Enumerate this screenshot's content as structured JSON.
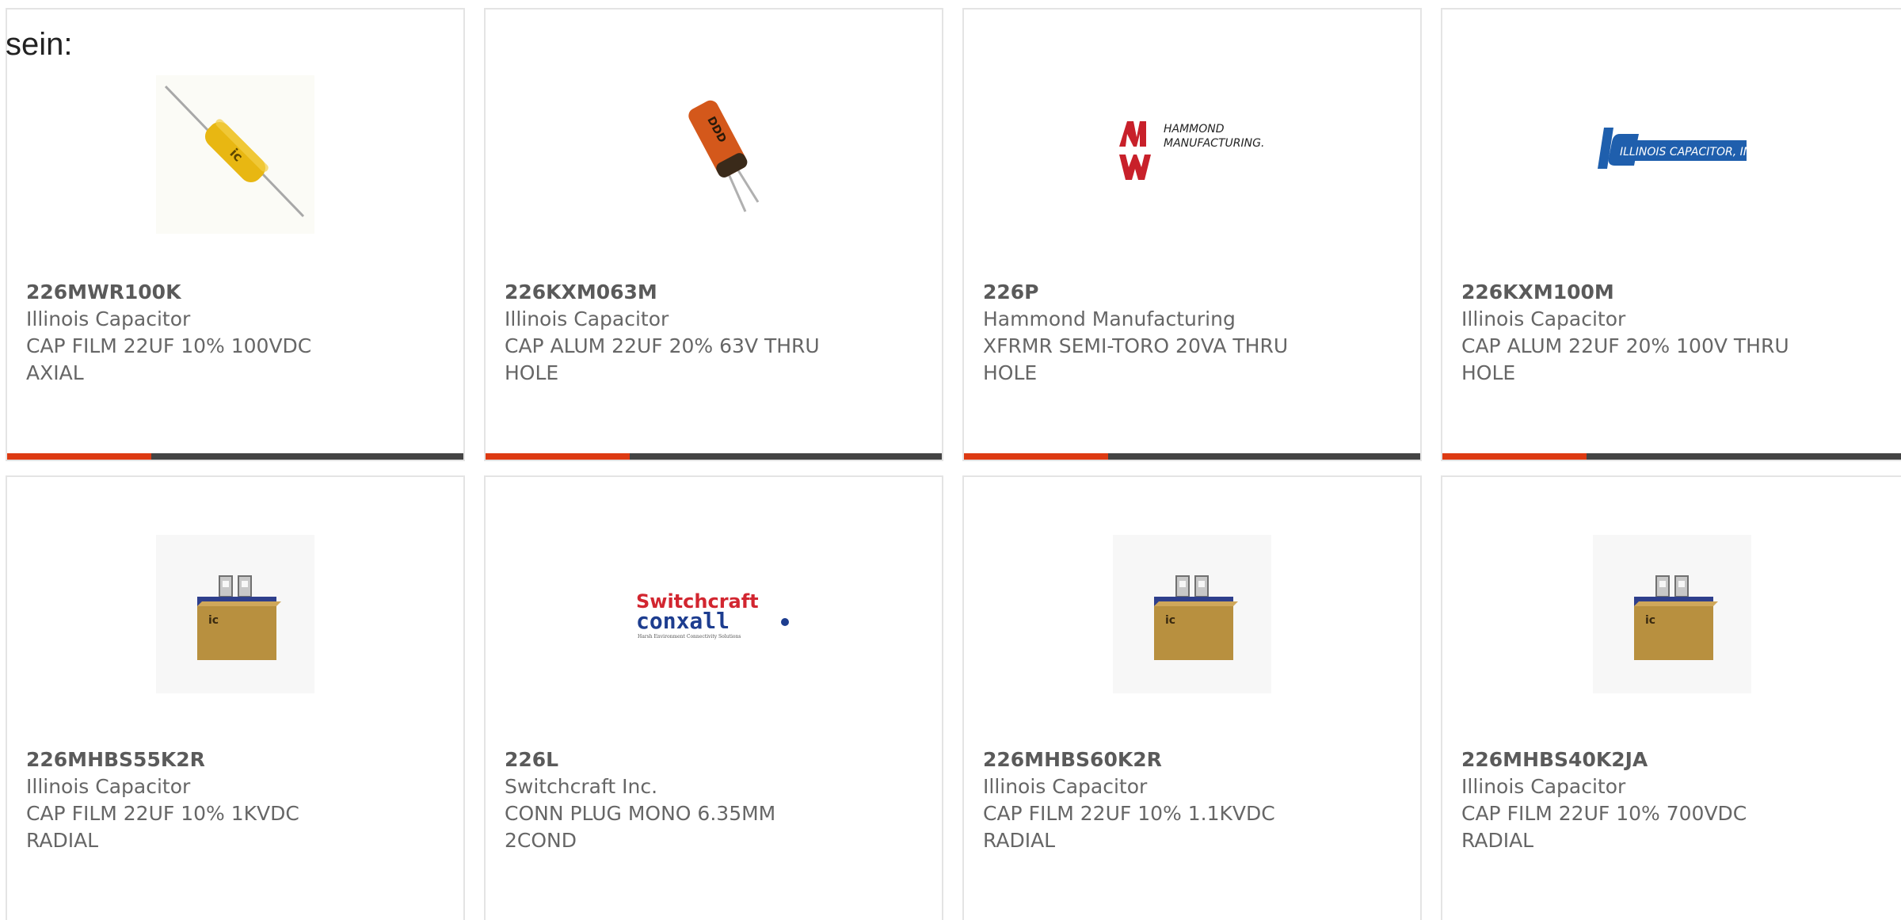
{
  "page": {
    "fragment_text": "sein:"
  },
  "accent_color": "#dd3a12",
  "bar_color": "#444444",
  "cards": [
    {
      "part_number": "226MWR100K",
      "manufacturer": "Illinois Capacitor",
      "description_line1": "CAP FILM 22UF 10% 100VDC",
      "description_line2": "AXIAL",
      "image": "axial-film-capacitor-image"
    },
    {
      "part_number": "226KXM063M",
      "manufacturer": "Illinois Capacitor",
      "description_line1": "CAP ALUM 22UF 20% 63V THRU",
      "description_line2": "HOLE",
      "image": "radial-electrolytic-capacitor-image"
    },
    {
      "part_number": "226P",
      "manufacturer": "Hammond Manufacturing",
      "description_line1": "XFRMR SEMI-TORO 20VA THRU",
      "description_line2": "HOLE",
      "image": "hammond-logo",
      "logo_text_line1": "HAMMOND",
      "logo_text_line2": "MANUFACTURING."
    },
    {
      "part_number": "226KXM100M",
      "manufacturer": "Illinois Capacitor",
      "description_line1": "CAP ALUM 22UF 20% 100V THRU",
      "description_line2": "HOLE",
      "image": "illinois-capacitor-logo",
      "logo_text": "ILLINOIS CAPACITOR, INC."
    },
    {
      "part_number": "226MHBS55K2R",
      "manufacturer": "Illinois Capacitor",
      "description_line1": "CAP FILM 22UF 10% 1KVDC",
      "description_line2": "RADIAL",
      "image": "box-film-capacitor-image"
    },
    {
      "part_number": "226L",
      "manufacturer": "Switchcraft Inc.",
      "description_line1": "CONN PLUG MONO 6.35MM",
      "description_line2": "2COND",
      "image": "switchcraft-conxall-logo",
      "logo_text_line1": "Switchcraft",
      "logo_text_line2": "conxall",
      "logo_tagline": "Harsh Environment Connectivity Solutions"
    },
    {
      "part_number": "226MHBS60K2R",
      "manufacturer": "Illinois Capacitor",
      "description_line1": "CAP FILM 22UF 10% 1.1KVDC",
      "description_line2": "RADIAL",
      "image": "box-film-capacitor-image"
    },
    {
      "part_number": "226MHBS40K2JA",
      "manufacturer": "Illinois Capacitor",
      "description_line1": "CAP FILM 22UF 10% 700VDC",
      "description_line2": "RADIAL",
      "image": "box-film-capacitor-image"
    }
  ]
}
